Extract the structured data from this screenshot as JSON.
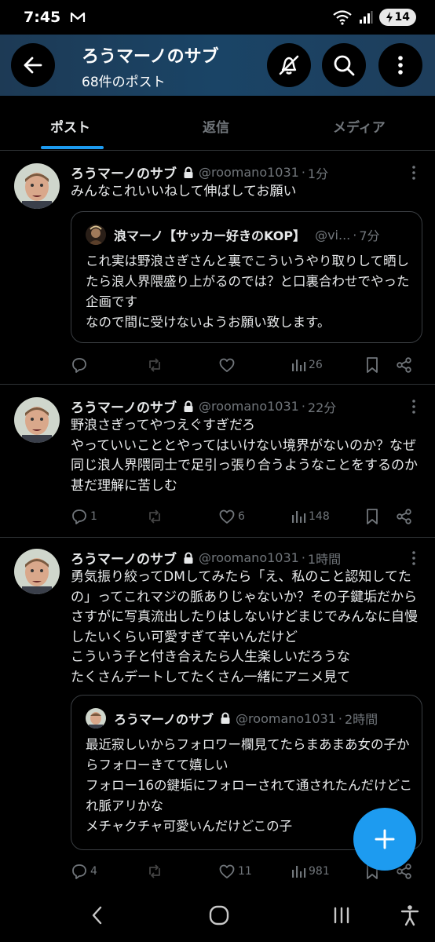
{
  "status_bar": {
    "time": "7:45",
    "battery": "14"
  },
  "header": {
    "title": "ろうマーノのサブ",
    "subtitle": "68件のポスト"
  },
  "tabs": [
    {
      "label": "ポスト"
    },
    {
      "label": "返信"
    },
    {
      "label": "メディア"
    }
  ],
  "posts": [
    {
      "name": "ろうマーノのサブ",
      "handle": "@roomano1031",
      "dot": "·",
      "time": "1分",
      "text": "みんなこれいいねして伸ばしてお願い",
      "quote": {
        "name": "浪マーノ【サッカー好きのKOP】",
        "handle": "@vi...",
        "dot": "·",
        "time": "7分",
        "text": "これ実は野浪さぎさんと裏でこういうやり取りして晒したら浪人界隈盛り上がるのでは？と口裏合わせでやった企画です\nなので間に受けないようお願い致します。"
      },
      "stats": {
        "replies": "",
        "reposts": "",
        "likes": "",
        "views": "26"
      }
    },
    {
      "name": "ろうマーノのサブ",
      "handle": "@roomano1031",
      "dot": "·",
      "time": "22分",
      "text": "野浪さぎってやつえぐすぎだろ\nやっていいこととやってはいけない境界がないのか？なぜ同じ浪人界隈同士で足引っ張り合うようなことをするのか甚だ理解に苦しむ",
      "stats": {
        "replies": "1",
        "reposts": "",
        "likes": "6",
        "views": "148"
      }
    },
    {
      "name": "ろうマーノのサブ",
      "handle": "@roomano1031",
      "dot": "·",
      "time": "1時間",
      "text": "勇気振り絞ってDMしてみたら「え、私のこと認知してたの」ってこれマジの脈ありじゃないか？その子鍵垢だからさすがに写真流出したりはしないけどまじでみんなに自慢したいくらい可愛すぎて辛いんだけど\nこういう子と付き合えたら人生楽しいだろうな\nたくさんデートしてたくさん一緒にアニメ見て",
      "quote": {
        "name": "ろうマーノのサブ",
        "handle": "@roomano1031",
        "dot": "·",
        "time": "2時間",
        "text": "最近寂しいからフォロワー欄見てたらまあまあ女の子からフォローきてて嬉しい\nフォロー16の鍵垢にフォローされて通されたんだけどこれ脈アリかな\nメチャクチャ可愛いんだけどこの子"
      },
      "stats": {
        "replies": "4",
        "reposts": "",
        "likes": "11",
        "views": "981"
      }
    }
  ],
  "icons": {
    "back": "arrow-left-icon",
    "notifications_off": "bell-off-icon",
    "search": "search-icon",
    "more": "more-vertical-icon",
    "compose": "plus-icon"
  },
  "colors": {
    "accent": "#1d9bf0",
    "header_bg": "#1a4466",
    "muted": "#71767b",
    "text": "#e7e9ea",
    "divider": "#2f3336"
  }
}
